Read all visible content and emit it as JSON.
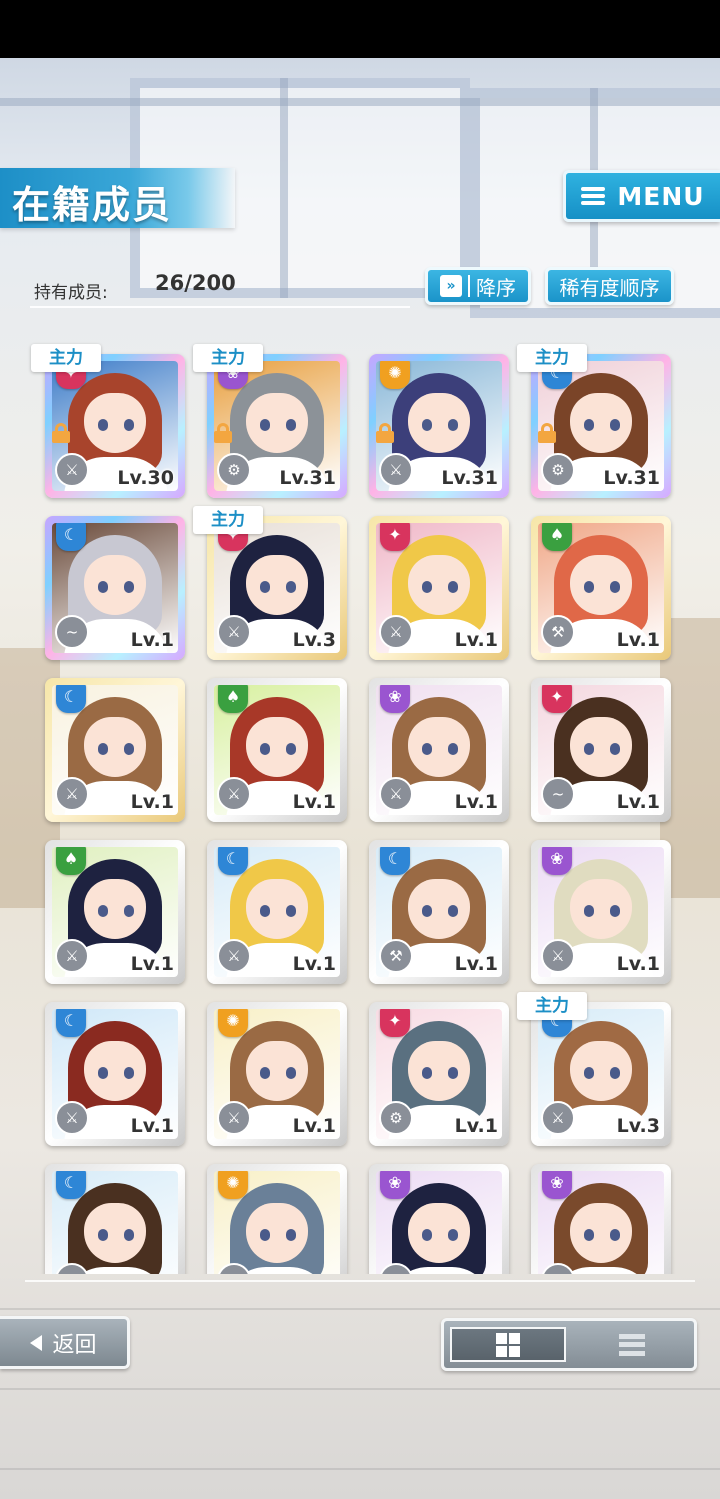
{
  "header": {
    "title": "在籍成员",
    "menu_label": "MENU"
  },
  "stats": {
    "owned_label": "持有成员:",
    "owned_value": "26/200"
  },
  "sort": {
    "order_label": "降序",
    "order_icon": "chevron-double-down-icon",
    "mode_label": "稀有度顺序"
  },
  "colors": {
    "accent_blue": "#1c8fc6",
    "attribute_moon": "#2e86d6",
    "attribute_sun": "#f0a020",
    "attribute_flower": "#9a55d0",
    "attribute_leaf": "#3aa040",
    "attribute_star": "#d8345e",
    "lock": "#f3a640"
  },
  "members": [
    {
      "level": "Lv.30",
      "main": "主力",
      "locked": true,
      "rarity": "rainbow",
      "attribute": "star",
      "weapon": "blade",
      "hair": "#a8442c",
      "bg": "#3d7cc8"
    },
    {
      "level": "Lv.31",
      "main": "主力",
      "locked": true,
      "rarity": "rainbow",
      "attribute": "flower",
      "weapon": "gear",
      "hair": "#8c9298",
      "bg": "#e8a040"
    },
    {
      "level": "Lv.31",
      "main": "",
      "locked": true,
      "rarity": "rainbow",
      "attribute": "sun",
      "weapon": "blade",
      "hair": "#3c3f7a",
      "bg": "#8ab8d8"
    },
    {
      "level": "Lv.31",
      "main": "主力",
      "locked": true,
      "rarity": "rainbow",
      "attribute": "moon",
      "weapon": "gear",
      "hair": "#7a4428",
      "bg": "#f0d0d8"
    },
    {
      "level": "Lv.1",
      "main": "",
      "locked": false,
      "rarity": "rainbow",
      "attribute": "moon",
      "weapon": "wave",
      "hair": "#c8c8d2",
      "bg": "#6a4a3a"
    },
    {
      "level": "Lv.3",
      "main": "主力",
      "locked": false,
      "rarity": "gold",
      "attribute": "star",
      "weapon": "blade",
      "hair": "#1e2240",
      "bg": "#e8e0d8"
    },
    {
      "level": "Lv.1",
      "main": "",
      "locked": false,
      "rarity": "gold",
      "attribute": "star",
      "weapon": "blade",
      "hair": "#f0c848",
      "bg": "#f0b8c8"
    },
    {
      "level": "Lv.1",
      "main": "",
      "locked": false,
      "rarity": "gold",
      "attribute": "leaf",
      "weapon": "hammer",
      "hair": "#e06848",
      "bg": "#f0a888"
    },
    {
      "level": "Lv.1",
      "main": "",
      "locked": false,
      "rarity": "gold",
      "attribute": "moon",
      "weapon": "blade",
      "hair": "#9a6a44",
      "bg": "#f8f2e0"
    },
    {
      "level": "Lv.1",
      "main": "",
      "locked": false,
      "rarity": "silver",
      "attribute": "leaf",
      "weapon": "blade",
      "hair": "#a83828",
      "bg": "#d8f0a0"
    },
    {
      "level": "Lv.1",
      "main": "",
      "locked": false,
      "rarity": "silver",
      "attribute": "flower",
      "weapon": "blade",
      "hair": "#9a6a44",
      "bg": "#f0e0f0"
    },
    {
      "level": "Lv.1",
      "main": "",
      "locked": false,
      "rarity": "silver",
      "attribute": "star",
      "weapon": "wave",
      "hair": "#4a3020",
      "bg": "#f4d8e0"
    },
    {
      "level": "Lv.1",
      "main": "",
      "locked": false,
      "rarity": "silver",
      "attribute": "leaf",
      "weapon": "blade",
      "hair": "#1e2240",
      "bg": "#e0f0c0"
    },
    {
      "level": "Lv.1",
      "main": "",
      "locked": false,
      "rarity": "silver",
      "attribute": "moon",
      "weapon": "blade",
      "hair": "#f0c848",
      "bg": "#d8ecf8"
    },
    {
      "level": "Lv.1",
      "main": "",
      "locked": false,
      "rarity": "silver",
      "attribute": "moon",
      "weapon": "hammer",
      "hair": "#9a6a44",
      "bg": "#d8ecf8"
    },
    {
      "level": "Lv.1",
      "main": "",
      "locked": false,
      "rarity": "silver",
      "attribute": "flower",
      "weapon": "blade",
      "hair": "#e0dcc0",
      "bg": "#ecdcf4"
    },
    {
      "level": "Lv.1",
      "main": "",
      "locked": false,
      "rarity": "silver",
      "attribute": "moon",
      "weapon": "blade",
      "hair": "#8a2a20",
      "bg": "#d0e8f8"
    },
    {
      "level": "Lv.1",
      "main": "",
      "locked": false,
      "rarity": "silver",
      "attribute": "sun",
      "weapon": "blade",
      "hair": "#9a6a44",
      "bg": "#f8f0c8"
    },
    {
      "level": "Lv.1",
      "main": "",
      "locked": false,
      "rarity": "silver",
      "attribute": "star",
      "weapon": "gear",
      "hair": "#5a7080",
      "bg": "#f8dce4"
    },
    {
      "level": "Lv.3",
      "main": "主力",
      "locked": false,
      "rarity": "silver",
      "attribute": "moon",
      "weapon": "blade",
      "hair": "#a06a44",
      "bg": "#d8ecf8"
    },
    {
      "level": "",
      "main": "",
      "locked": false,
      "rarity": "silver",
      "attribute": "moon",
      "weapon": "blade",
      "hair": "#4a3020",
      "bg": "#d8ecf8"
    },
    {
      "level": "",
      "main": "",
      "locked": false,
      "rarity": "silver",
      "attribute": "sun",
      "weapon": "blade",
      "hair": "#6a8098",
      "bg": "#f8f0c8"
    },
    {
      "level": "",
      "main": "",
      "locked": false,
      "rarity": "silver",
      "attribute": "flower",
      "weapon": "blade",
      "hair": "#1e2240",
      "bg": "#ecdcf4"
    },
    {
      "level": "",
      "main": "",
      "locked": false,
      "rarity": "silver",
      "attribute": "flower",
      "weapon": "blade",
      "hair": "#7a4a2c",
      "bg": "#ecdcf4"
    }
  ],
  "footer": {
    "back_label": "返回",
    "grid_view_icon": "grid-view-icon",
    "list_view_icon": "list-view-icon"
  }
}
